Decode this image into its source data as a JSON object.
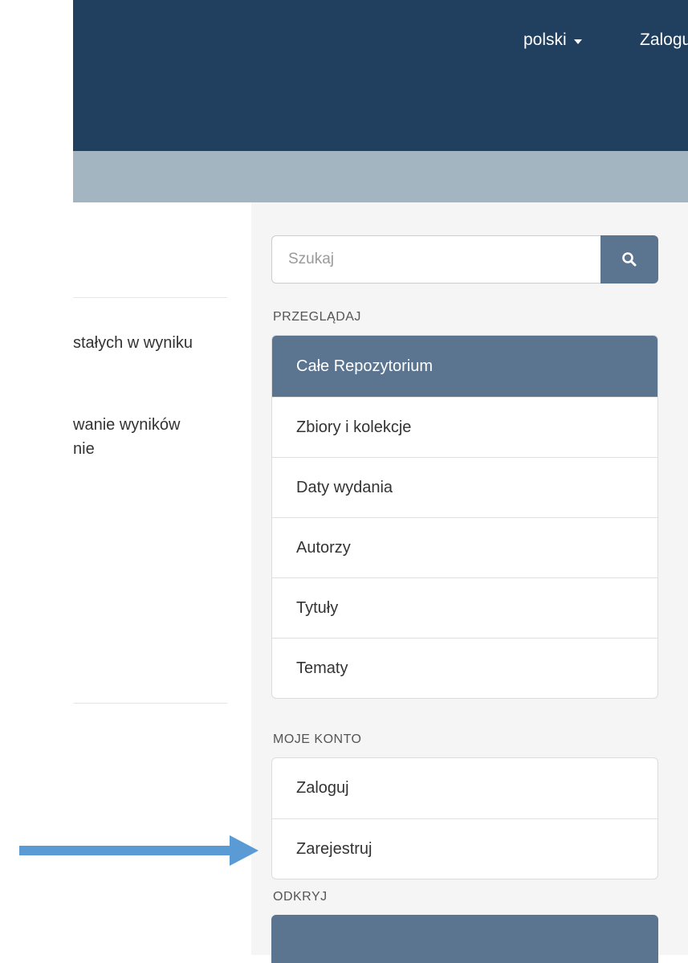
{
  "header": {
    "language_label": "polski",
    "login_label": "Zaloguj"
  },
  "content": {
    "fragments": [
      "stałych w wyniku",
      "wanie wyników",
      "nie"
    ]
  },
  "search": {
    "placeholder": "Szukaj"
  },
  "browse": {
    "heading": "PRZEGLĄDAJ",
    "items": [
      {
        "label": "Całe Repozytorium",
        "active": true
      },
      {
        "label": "Zbiory i kolekcje"
      },
      {
        "label": "Daty wydania"
      },
      {
        "label": "Autorzy"
      },
      {
        "label": "Tytuły"
      },
      {
        "label": "Tematy"
      }
    ]
  },
  "account": {
    "heading": "MOJE KONTO",
    "items": [
      {
        "label": "Zaloguj"
      },
      {
        "label": "Zarejestruj"
      }
    ]
  },
  "discover": {
    "heading": "ODKRYJ"
  },
  "colors": {
    "header_bg": "#213f5e",
    "breadcrumb_bg": "#a4b5c2",
    "accent": "#5b7590",
    "annotation_arrow": "#5b9bd5"
  }
}
